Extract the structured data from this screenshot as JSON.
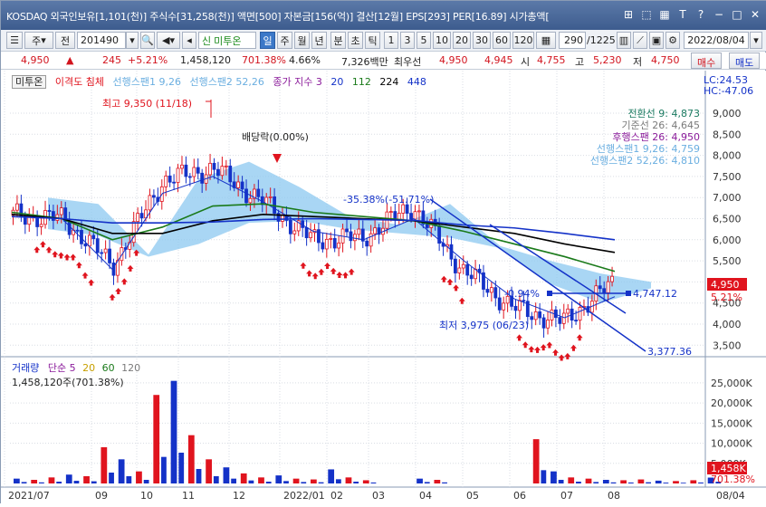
{
  "titlebar": {
    "title": "KOSDAQ 외국인보유[1,101(천)] 주식수[31,258(천)] 액면[500] 자본금[156(억)] 결산[12월] EPS[293] PER[16.89] 시가총액[",
    "buttons": [
      "⊞",
      "⬚",
      "▦",
      "T",
      "?",
      "−",
      "□",
      "✕"
    ]
  },
  "toolbar": {
    "scope": "주",
    "prev": "전",
    "code": "201490",
    "name": "미투온",
    "periods": [
      "일",
      "주",
      "월",
      "년",
      "분",
      "초",
      "틱"
    ],
    "minutes": [
      "1",
      "3",
      "5",
      "10",
      "20",
      "30",
      "60",
      "120"
    ],
    "count": "290",
    "total": "/1225",
    "date": "2022/08/04"
  },
  "quote": {
    "price": "4,950",
    "change": "245",
    "change_pct": "+5.21%",
    "volume": "1,458,120",
    "volume_ratio": "701.38%",
    "turnover": "4.66%",
    "amount": "7,326백만",
    "ask_label": "최우선",
    "ask": "4,950",
    "bid": "4,945",
    "open_label": "시",
    "open": "4,755",
    "high_label": "고",
    "high": "5,230",
    "low_label": "저",
    "low": "4,750",
    "buy": "매수",
    "sell": "매도"
  },
  "legend": {
    "name": "미투온",
    "items": [
      "이격도 침체",
      "선행스팬1 9,26",
      "선행스팬2 52,26",
      "종가 지수 3",
      "20",
      "112",
      "224",
      "448"
    ],
    "volume_items": [
      "거래량",
      "단순 5",
      "20",
      "60",
      "120"
    ],
    "volume_value": "1,458,120주(701.38%)"
  },
  "ichimoku_labels": {
    "lc": "LC:24.53",
    "hc": "HC:-47.06",
    "conv": "전환선 9: 4,873",
    "base": "기준선 26: 4,645",
    "lag": "후행스팬 26: 4,950",
    "lead1": "선행스팬1 9,26: 4,759",
    "lead2": "선행스팬2 52,26: 4,810"
  },
  "annotations": {
    "high": "최고 9,350 (11/18)",
    "low": "최저 3,975 (06/23)",
    "dividend": "배당락(0.00%)",
    "drop": "-35.38%(-51.71%)",
    "flat": "-0.94%",
    "trend_end": "3,377.36",
    "hline_value": "4,747.12"
  },
  "colors": {
    "up": "#e0141e",
    "down": "#1432c8",
    "cloud": "#8cc8f0",
    "ma20": "#1432c8",
    "ma112": "#1a7a1a",
    "ma224": "#000000",
    "ma448": "#1432c8",
    "accent": "#3b78c8"
  },
  "chart_data": {
    "type": "line",
    "title": "",
    "xlabel": "",
    "ylabel": "",
    "ylim": [
      3300,
      9300
    ],
    "x": [
      "2021/07",
      "09",
      "10",
      "11",
      "12",
      "2022/01",
      "02",
      "03",
      "04",
      "05",
      "06",
      "07",
      "08"
    ],
    "series": [
      {
        "name": "종가",
        "values": [
          6580,
          6500,
          5400,
          7400,
          7700,
          6900,
          6000,
          6050,
          6800,
          5300,
          4400,
          4050,
          4950
        ]
      },
      {
        "name": "20",
        "values": [
          6650,
          6500,
          5300,
          7100,
          7500,
          6900,
          6200,
          6000,
          6500,
          5500,
          4600,
          4150,
          4650
        ]
      },
      {
        "name": "112",
        "values": [
          6650,
          6500,
          6000,
          6300,
          6800,
          6850,
          6650,
          6550,
          6450,
          6200,
          5900,
          5600,
          5250
        ]
      },
      {
        "name": "224",
        "values": [
          6600,
          6500,
          6150,
          6150,
          6450,
          6600,
          6550,
          6500,
          6450,
          6300,
          6150,
          5900,
          5700
        ]
      },
      {
        "name": "448",
        "values": [
          6550,
          6500,
          6400,
          6400,
          6420,
          6480,
          6500,
          6480,
          6460,
          6350,
          6280,
          6150,
          6000
        ]
      }
    ],
    "y_ticks": [
      "9,000",
      "8,500",
      "8,000",
      "7,500",
      "7,000",
      "6,500",
      "6,000",
      "5,500",
      "5,000",
      "4,500",
      "4,000",
      "3,500"
    ],
    "x_ticks": [
      "2021/07",
      "09",
      "10",
      "11",
      "12",
      "2022/01",
      "02",
      "03",
      "04",
      "05",
      "06",
      "07",
      "08",
      "08/04"
    ],
    "volume_ticks": [
      "25,000K",
      "20,000K",
      "15,000K",
      "10,000K",
      "5,000K"
    ],
    "current_price": "4,950",
    "current_pct": "5.21%",
    "volume_current": "1,458K",
    "volume_pct": "701.38%",
    "volume": {
      "ylim": [
        0,
        27000
      ],
      "values": [
        1200,
        900,
        1500,
        2200,
        1800,
        9000,
        6000,
        3000,
        22000,
        25500,
        12000,
        6000,
        4000,
        2500,
        1500,
        2000,
        1200,
        1000,
        3500,
        1500,
        800,
        1200,
        900,
        11000,
        3000,
        1500,
        1200,
        900,
        800,
        1000,
        700,
        600,
        800,
        1458
      ]
    }
  }
}
